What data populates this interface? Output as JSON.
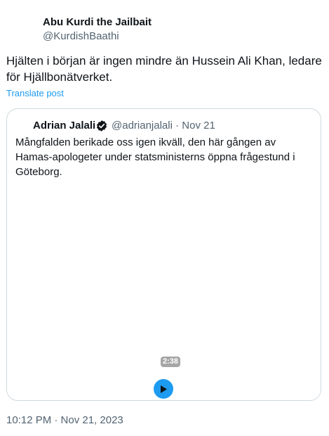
{
  "tweet": {
    "author_name": "Abu Kurdi the Jailbait",
    "author_handle": "@KurdishBaathi",
    "text": "Hjälten i början är ingen mindre än Hussein Ali Khan, ledare för Hjällbonätverket.",
    "translate_label": "Translate post",
    "timestamp": "10:12 PM · Nov 21, 2023"
  },
  "quote": {
    "author_name": "Adrian Jalali",
    "author_handle": "@adrianjalali",
    "separator": "·",
    "date": "Nov 21",
    "verified_icon": "verified-badge-icon",
    "text": "Mångfalden berikade oss igen ikväll, den här gången av Hamas-apologeter under statsministerns öppna frågestund i Göteborg.",
    "video": {
      "duration": "2:38",
      "play_icon": "play-icon"
    }
  },
  "colors": {
    "text_primary": "#0f1419",
    "text_secondary": "#536471",
    "accent": "#1d9bf0",
    "border": "#cfd9de"
  }
}
